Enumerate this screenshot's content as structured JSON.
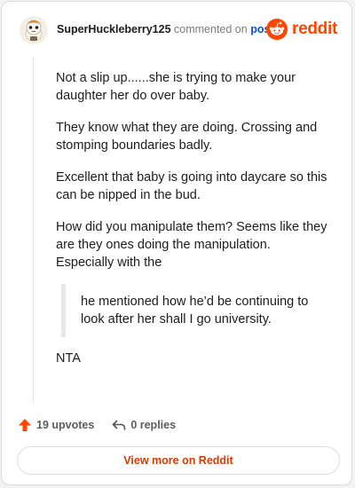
{
  "header": {
    "username": "SuperHuckleberry125",
    "action_text": "commented on",
    "post_link": "post",
    "brand": "reddit"
  },
  "comment": {
    "paragraphs": [
      "Not a slip up......she is trying to make your daughter her do over baby.",
      "They know what they are doing. Crossing and stomping boundaries badly.",
      "Excellent that baby is going into daycare so this can be nipped in the bud.",
      "How did you manipulate them? Seems like they are they ones doing the manipulation. Especially with the"
    ],
    "quote": "he mentioned how he’d be continuing to look after her shall I go university.",
    "closing": "NTA"
  },
  "actions": {
    "upvotes": "19 upvotes",
    "replies": "0 replies"
  },
  "view_more": "View more on Reddit",
  "colors": {
    "brand": "#ff4500",
    "link": "#0a4fcf",
    "view_more_text": "#d93a00"
  },
  "icons": [
    "snoo-avatar-icon",
    "reddit-logo-icon",
    "upvote-arrow-icon",
    "reply-arrow-icon"
  ]
}
